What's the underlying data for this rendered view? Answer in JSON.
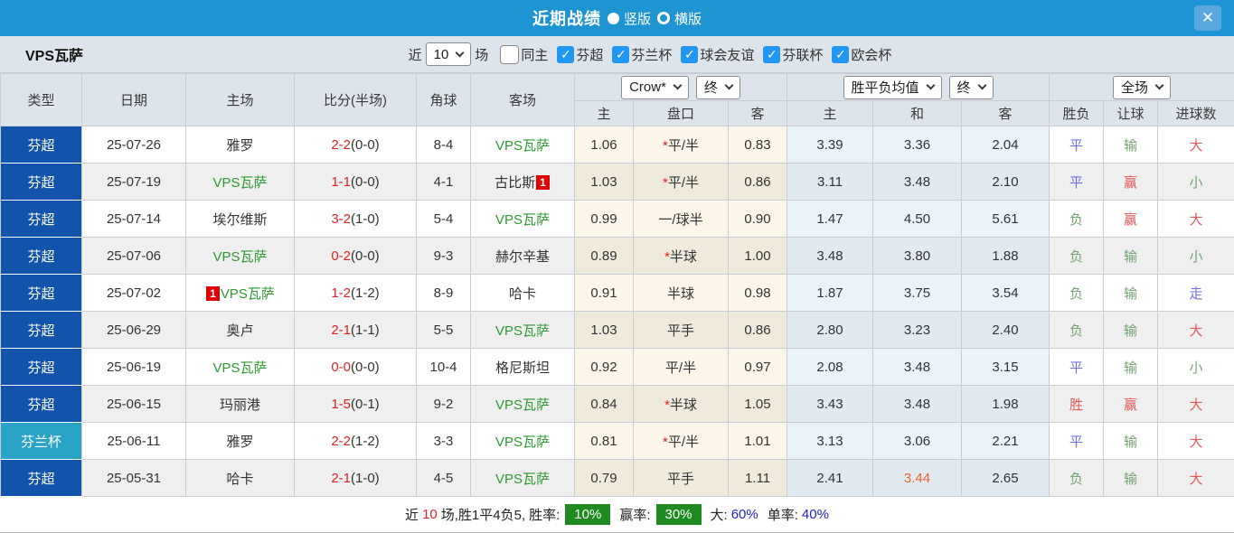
{
  "titlebar": {
    "title": "近期战绩",
    "radio_vertical": "竖版",
    "radio_horizontal": "横版"
  },
  "icons": {
    "close": "✕",
    "check": "✓"
  },
  "filterbar": {
    "team": "VPS瓦萨",
    "near_label": "近",
    "near_value": "10",
    "games_label": "场",
    "same_home_label": "同主",
    "leagues": [
      "芬超",
      "芬兰杯",
      "球会友谊",
      "芬联杯",
      "欧会杯"
    ]
  },
  "table": {
    "static_headers": [
      "类型",
      "日期",
      "主场",
      "比分(半场)",
      "角球",
      "客场"
    ],
    "group1": {
      "select1": "Crow*",
      "select2": "终",
      "cols": [
        "主",
        "盘口",
        "客"
      ]
    },
    "group2": {
      "select1": "胜平负均值",
      "select2": "终",
      "cols": [
        "主",
        "和",
        "客"
      ]
    },
    "group3": {
      "select1": "全场",
      "cols": [
        "胜负",
        "让球",
        "进球数"
      ]
    },
    "rows": [
      {
        "type": "芬超",
        "type_class": "league",
        "date": "25-07-26",
        "home": {
          "name": "雅罗",
          "vps": false,
          "badge": null,
          "badge_before": false
        },
        "score": "2-2",
        "half": "(0-0)",
        "corner": "8-4",
        "away": {
          "name": "VPS瓦萨",
          "vps": true,
          "badge": null,
          "badge_before": false
        },
        "crow": {
          "home": "1.06",
          "star": true,
          "line": "平/半",
          "away": "0.83"
        },
        "avg": {
          "home": "3.39",
          "draw": "3.36",
          "away": "2.04",
          "draw_hot": false
        },
        "results": {
          "wdl": {
            "text": "平",
            "color": "blue"
          },
          "handicap": {
            "text": "输",
            "color": "green"
          },
          "goals": {
            "text": "大",
            "color": "red"
          }
        }
      },
      {
        "type": "芬超",
        "type_class": "league",
        "date": "25-07-19",
        "home": {
          "name": "VPS瓦萨",
          "vps": true,
          "badge": null,
          "badge_before": false
        },
        "score": "1-1",
        "half": "(0-0)",
        "corner": "4-1",
        "away": {
          "name": "古比斯",
          "vps": false,
          "badge": "1",
          "badge_before": false
        },
        "crow": {
          "home": "1.03",
          "star": true,
          "line": "平/半",
          "away": "0.86"
        },
        "avg": {
          "home": "3.11",
          "draw": "3.48",
          "away": "2.10",
          "draw_hot": false
        },
        "results": {
          "wdl": {
            "text": "平",
            "color": "blue"
          },
          "handicap": {
            "text": "赢",
            "color": "red"
          },
          "goals": {
            "text": "小",
            "color": "green"
          }
        }
      },
      {
        "type": "芬超",
        "type_class": "league",
        "date": "25-07-14",
        "home": {
          "name": "埃尔维斯",
          "vps": false,
          "badge": null,
          "badge_before": false
        },
        "score": "3-2",
        "half": "(1-0)",
        "corner": "5-4",
        "away": {
          "name": "VPS瓦萨",
          "vps": true,
          "badge": null,
          "badge_before": false
        },
        "crow": {
          "home": "0.99",
          "star": false,
          "line": "一/球半",
          "away": "0.90"
        },
        "avg": {
          "home": "1.47",
          "draw": "4.50",
          "away": "5.61",
          "draw_hot": false
        },
        "results": {
          "wdl": {
            "text": "负",
            "color": "green"
          },
          "handicap": {
            "text": "赢",
            "color": "red"
          },
          "goals": {
            "text": "大",
            "color": "red"
          }
        }
      },
      {
        "type": "芬超",
        "type_class": "league",
        "date": "25-07-06",
        "home": {
          "name": "VPS瓦萨",
          "vps": true,
          "badge": null,
          "badge_before": false
        },
        "score": "0-2",
        "half": "(0-0)",
        "corner": "9-3",
        "away": {
          "name": "赫尔辛基",
          "vps": false,
          "badge": null,
          "badge_before": false
        },
        "crow": {
          "home": "0.89",
          "star": true,
          "line": "半球",
          "away": "1.00"
        },
        "avg": {
          "home": "3.48",
          "draw": "3.80",
          "away": "1.88",
          "draw_hot": false
        },
        "results": {
          "wdl": {
            "text": "负",
            "color": "green"
          },
          "handicap": {
            "text": "输",
            "color": "green"
          },
          "goals": {
            "text": "小",
            "color": "green"
          }
        }
      },
      {
        "type": "芬超",
        "type_class": "league",
        "date": "25-07-02",
        "home": {
          "name": "VPS瓦萨",
          "vps": true,
          "badge": "1",
          "badge_before": true
        },
        "score": "1-2",
        "half": "(1-2)",
        "corner": "8-9",
        "away": {
          "name": "哈卡",
          "vps": false,
          "badge": null,
          "badge_before": false
        },
        "crow": {
          "home": "0.91",
          "star": false,
          "line": "半球",
          "away": "0.98"
        },
        "avg": {
          "home": "1.87",
          "draw": "3.75",
          "away": "3.54",
          "draw_hot": false
        },
        "results": {
          "wdl": {
            "text": "负",
            "color": "green"
          },
          "handicap": {
            "text": "输",
            "color": "green"
          },
          "goals": {
            "text": "走",
            "color": "blue"
          }
        }
      },
      {
        "type": "芬超",
        "type_class": "league",
        "date": "25-06-29",
        "home": {
          "name": "奥卢",
          "vps": false,
          "badge": null,
          "badge_before": false
        },
        "score": "2-1",
        "half": "(1-1)",
        "corner": "5-5",
        "away": {
          "name": "VPS瓦萨",
          "vps": true,
          "badge": null,
          "badge_before": false
        },
        "crow": {
          "home": "1.03",
          "star": false,
          "line": "平手",
          "away": "0.86"
        },
        "avg": {
          "home": "2.80",
          "draw": "3.23",
          "away": "2.40",
          "draw_hot": false
        },
        "results": {
          "wdl": {
            "text": "负",
            "color": "green"
          },
          "handicap": {
            "text": "输",
            "color": "green"
          },
          "goals": {
            "text": "大",
            "color": "red"
          }
        }
      },
      {
        "type": "芬超",
        "type_class": "league",
        "date": "25-06-19",
        "home": {
          "name": "VPS瓦萨",
          "vps": true,
          "badge": null,
          "badge_before": false
        },
        "score": "0-0",
        "half": "(0-0)",
        "corner": "10-4",
        "away": {
          "name": "格尼斯坦",
          "vps": false,
          "badge": null,
          "badge_before": false
        },
        "crow": {
          "home": "0.92",
          "star": false,
          "line": "平/半",
          "away": "0.97"
        },
        "avg": {
          "home": "2.08",
          "draw": "3.48",
          "away": "3.15",
          "draw_hot": false
        },
        "results": {
          "wdl": {
            "text": "平",
            "color": "blue"
          },
          "handicap": {
            "text": "输",
            "color": "green"
          },
          "goals": {
            "text": "小",
            "color": "green"
          }
        }
      },
      {
        "type": "芬超",
        "type_class": "league",
        "date": "25-06-15",
        "home": {
          "name": "玛丽港",
          "vps": false,
          "badge": null,
          "badge_before": false
        },
        "score": "1-5",
        "half": "(0-1)",
        "corner": "9-2",
        "away": {
          "name": "VPS瓦萨",
          "vps": true,
          "badge": null,
          "badge_before": false
        },
        "crow": {
          "home": "0.84",
          "star": true,
          "line": "半球",
          "away": "1.05"
        },
        "avg": {
          "home": "3.43",
          "draw": "3.48",
          "away": "1.98",
          "draw_hot": false
        },
        "results": {
          "wdl": {
            "text": "胜",
            "color": "red"
          },
          "handicap": {
            "text": "赢",
            "color": "red"
          },
          "goals": {
            "text": "大",
            "color": "red"
          }
        }
      },
      {
        "type": "芬兰杯",
        "type_class": "cup",
        "date": "25-06-11",
        "home": {
          "name": "雅罗",
          "vps": false,
          "badge": null,
          "badge_before": false
        },
        "score": "2-2",
        "half": "(1-2)",
        "corner": "3-3",
        "away": {
          "name": "VPS瓦萨",
          "vps": true,
          "badge": null,
          "badge_before": false
        },
        "crow": {
          "home": "0.81",
          "star": true,
          "line": "平/半",
          "away": "1.01"
        },
        "avg": {
          "home": "3.13",
          "draw": "3.06",
          "away": "2.21",
          "draw_hot": false
        },
        "results": {
          "wdl": {
            "text": "平",
            "color": "blue"
          },
          "handicap": {
            "text": "输",
            "color": "green"
          },
          "goals": {
            "text": "大",
            "color": "red"
          }
        }
      },
      {
        "type": "芬超",
        "type_class": "league",
        "date": "25-05-31",
        "home": {
          "name": "哈卡",
          "vps": false,
          "badge": null,
          "badge_before": false
        },
        "score": "2-1",
        "half": "(1-0)",
        "corner": "4-5",
        "away": {
          "name": "VPS瓦萨",
          "vps": true,
          "badge": null,
          "badge_before": false
        },
        "crow": {
          "home": "0.79",
          "star": false,
          "line": "平手",
          "away": "1.11"
        },
        "avg": {
          "home": "2.41",
          "draw": "3.44",
          "away": "2.65",
          "draw_hot": true
        },
        "results": {
          "wdl": {
            "text": "负",
            "color": "green"
          },
          "handicap": {
            "text": "输",
            "color": "green"
          },
          "goals": {
            "text": "大",
            "color": "red"
          }
        }
      }
    ]
  },
  "footer": {
    "near_label": "近",
    "games_count": "10",
    "summary": "场,胜1平4负5,",
    "win_rate_label": "胜率:",
    "win_rate": "10%",
    "handicap_rate_label": "赢率:",
    "handicap_rate": "30%",
    "big_label": "大:",
    "big_rate": "60%",
    "single_label": "单率:",
    "single_rate": "40%"
  },
  "colors": {
    "topbar_bg": "#1E95D2",
    "band_bg": "#DEE4EC",
    "league_bg": "#1254AB",
    "cup_bg": "#29A3C6",
    "score_red": "#E02222",
    "vps_green": "#2E9932",
    "result_red": "#E25A5A",
    "result_green": "#74A274",
    "result_blue": "#7070DD",
    "hot_orange": "#E8622E",
    "badge_green": "#1F8A1F",
    "rate_blue": "#2222CC",
    "checkbox_blue": "#2196F3"
  }
}
